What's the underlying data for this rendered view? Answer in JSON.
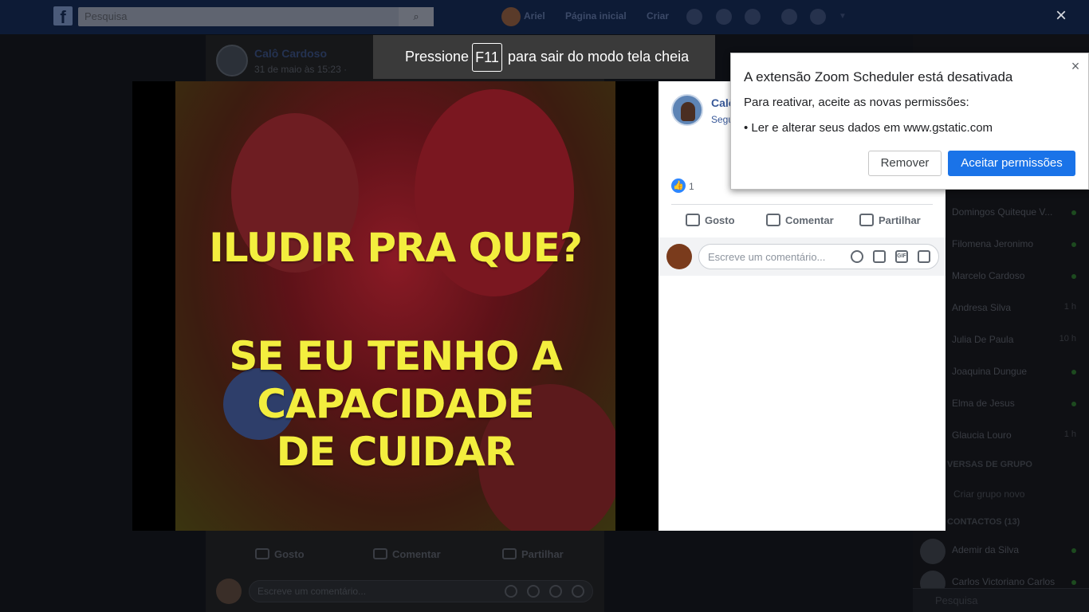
{
  "background": {
    "search_placeholder": "Pesquisa",
    "nav": {
      "user": "Ariel",
      "home": "Página inicial",
      "create": "Criar"
    },
    "post": {
      "author": "Calô Cardoso",
      "time": "31 de maio às 15:23 ·",
      "actions": {
        "like": "Gosto",
        "comment": "Comentar",
        "share": "Partilhar"
      },
      "comment_placeholder": "Escreve um comentário..."
    },
    "chat": {
      "contacts": [
        {
          "name": "Domingos Quiteque V...",
          "status": "online"
        },
        {
          "name": "Filomena Jeronimo",
          "status": "online"
        },
        {
          "name": "Marcelo Cardoso",
          "status": "online"
        },
        {
          "name": "Andresa Silva",
          "status": "1 h"
        },
        {
          "name": "Julia De Paula",
          "status": "10 h"
        },
        {
          "name": "Joaquina Dungue",
          "status": "online"
        },
        {
          "name": "Elma de Jesus",
          "status": "online"
        },
        {
          "name": "Glaucia Louro",
          "status": "1 h"
        }
      ],
      "group_header": "VERSAS DE GRUPO",
      "create_group": "Criar grupo novo",
      "contacts_header": "CONTACTOS (13)",
      "more_contacts": [
        {
          "name": "Ademir da Silva",
          "status": "online"
        },
        {
          "name": "Carlos Victoriano Carlos",
          "status": "online"
        }
      ],
      "search_placeholder": "Pesquisa"
    }
  },
  "viewer": {
    "close_label": "×",
    "photo_text": [
      "ILUDIR PRA QUE?",
      "SE EU TENHO A",
      "CAPACIDADE",
      "DE CUIDAR"
    ],
    "author": "Calô",
    "follow": "Segu",
    "like_count": "1",
    "actions": {
      "like": "Gosto",
      "comment": "Comentar",
      "share": "Partilhar"
    },
    "comment_placeholder": "Escreve um comentário...",
    "comment_icon_gif": "GIF"
  },
  "fullscreen_banner": {
    "text_before": "Pressione",
    "key": "F11",
    "text_after": "para sair do modo tela cheia"
  },
  "extension_dialog": {
    "title": "A extensão Zoom Scheduler está desativada",
    "body": "Para reativar, aceite as novas permissões:",
    "permission": "• Ler e alterar seus dados em www.gstatic.com",
    "remove_label": "Remover",
    "accept_label": "Aceitar permissões",
    "close_label": "×"
  },
  "colors": {
    "accent": "#1a73e8",
    "fb_blue": "#385898",
    "photo_text": "#f3ee3e",
    "like_badge": "#2d86ff"
  }
}
